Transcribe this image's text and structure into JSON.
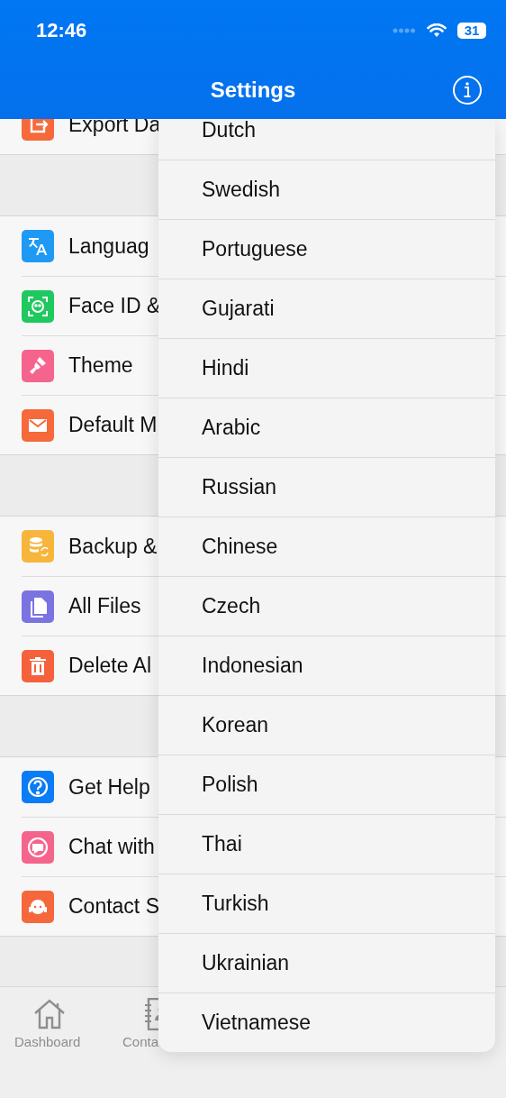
{
  "status_bar": {
    "time": "12:46",
    "battery": "31"
  },
  "nav_bar": {
    "title": "Settings"
  },
  "sections": [
    {
      "rows": [
        {
          "label": "Export Da",
          "color": "#f5693b"
        }
      ]
    },
    {
      "rows": [
        {
          "label": "Languag",
          "color": "#1e9af5"
        },
        {
          "label": "Face ID &",
          "color": "#1fc95f"
        },
        {
          "label": "Theme",
          "color": "#f5648c"
        },
        {
          "label": "Default M",
          "color": "#f5693b"
        }
      ]
    },
    {
      "rows": [
        {
          "label": "Backup &",
          "color": "#f8b53b"
        },
        {
          "label": "All Files",
          "color": "#7b73e1"
        },
        {
          "label": "Delete Al",
          "color": "#f5613b"
        }
      ]
    },
    {
      "rows": [
        {
          "label": "Get Help",
          "color": "#0a7cf5"
        },
        {
          "label": "Chat with",
          "color": "#f5648c"
        },
        {
          "label": "Contact S",
          "color": "#f5683b"
        }
      ]
    }
  ],
  "tab_bar": [
    {
      "label": "Dashboard"
    },
    {
      "label": "Conta"
    }
  ],
  "dropdown": {
    "items": [
      "Dutch",
      "Swedish",
      "Portuguese",
      "Gujarati",
      "Hindi",
      "Arabic",
      "Russian",
      "Chinese",
      "Czech",
      "Indonesian",
      "Korean",
      "Polish",
      "Thai",
      "Turkish",
      "Ukrainian",
      "Vietnamese"
    ]
  }
}
